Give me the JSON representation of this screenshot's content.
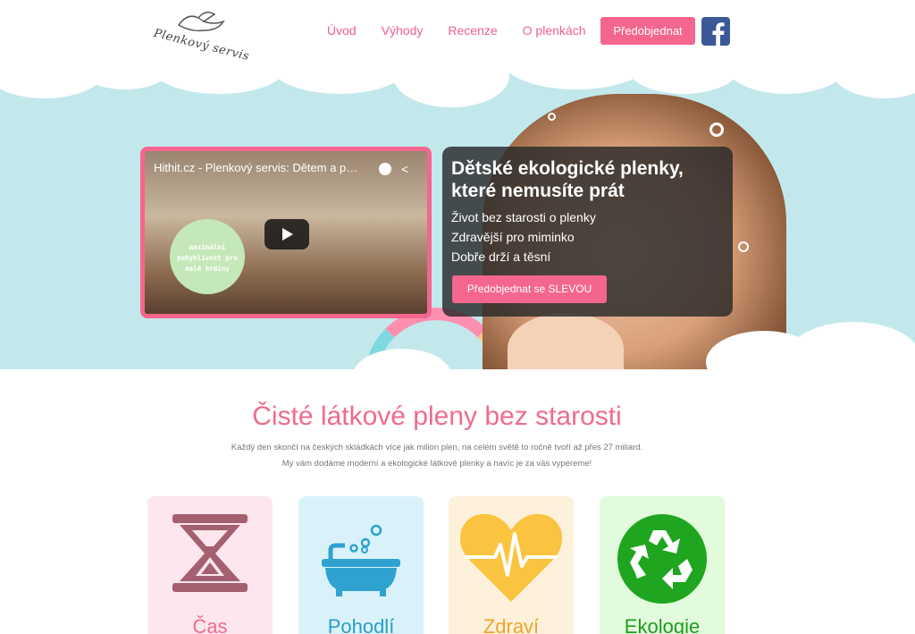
{
  "header": {
    "logo_text": "Plenkový servis",
    "nav": [
      "Úvod",
      "Výhody",
      "Recenze",
      "O plenkách"
    ],
    "cta": "Předobjednat",
    "social_icon": "facebook-icon"
  },
  "hero": {
    "video": {
      "title": "Hithit.cz - Plenkový servis: Dětem a při...",
      "bubble_text": "maximální pohyblivost pro malé hrdiny"
    },
    "title": "Dětské ekologické plenky, které nemusíte prát",
    "lines": [
      "Život bez starosti o plenky",
      "Zdravější pro miminko",
      "Dobře drží a těsní"
    ],
    "cta": "Předobjednat se SLEVOU"
  },
  "intro": {
    "title": "Čisté látkové pleny bez starosti",
    "paragraph_1": "Každý den skončí na českých skládkách více jak milion plen, na celém světě to ročně tvoří až přes 27 miliard.",
    "paragraph_2": "My vám dodáme moderní a ekologické látkové plenky a navíc je za vás vypereme!"
  },
  "cards": [
    {
      "label": "Čas",
      "icon": "hourglass-icon",
      "bg": "#fde6ee",
      "color": "#f06b8c",
      "icon_color": "#a4606f"
    },
    {
      "label": "Pohodlí",
      "icon": "bathtub-icon",
      "bg": "#d9f2fa",
      "color": "#2d9cc7",
      "icon_color": "#2fa2cf"
    },
    {
      "label": "Zdraví",
      "icon": "heart-icon",
      "bg": "#fdf1dc",
      "color": "#f0a427",
      "icon_color": "#fbc440"
    },
    {
      "label": "Ekologie",
      "icon": "recycle-icon",
      "bg": "#e1fbdc",
      "color": "#1f9b1f",
      "icon_color": "#1fa51f"
    }
  ],
  "colors": {
    "accent": "#f4668e",
    "hero_bg": "#c3e8ec"
  }
}
